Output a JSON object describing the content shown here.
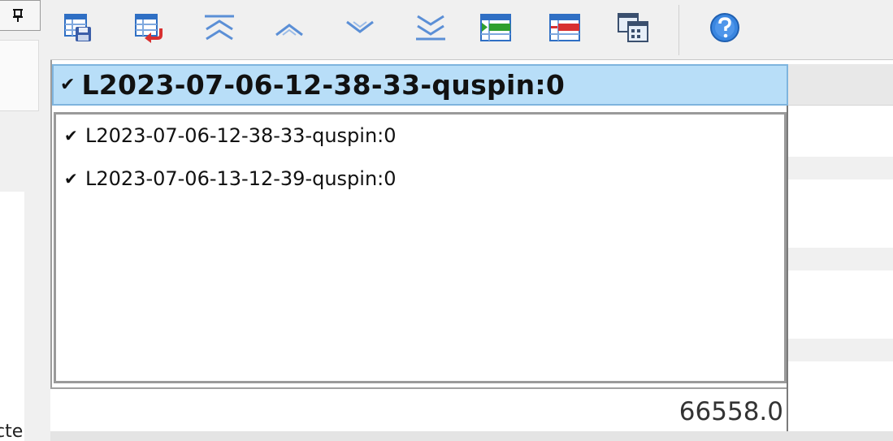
{
  "left_panel": {
    "pin_icon": "pin-icon",
    "truncated_text": "cte"
  },
  "toolbar": {
    "buttons": [
      {
        "name": "save-table",
        "icon": "table-save-icon"
      },
      {
        "name": "load-table",
        "icon": "table-load-icon"
      },
      {
        "name": "move-top",
        "icon": "double-chevron-up-icon"
      },
      {
        "name": "move-up",
        "icon": "chevron-up-icon"
      },
      {
        "name": "move-down",
        "icon": "chevron-down-icon"
      },
      {
        "name": "move-bottom",
        "icon": "double-chevron-down-icon"
      },
      {
        "name": "add-row",
        "icon": "table-add-icon"
      },
      {
        "name": "remove-row",
        "icon": "table-remove-icon"
      },
      {
        "name": "grid-view",
        "icon": "grid-window-icon"
      },
      {
        "name": "help",
        "icon": "help-icon"
      }
    ],
    "colors": {
      "table_blue": "#2f6fc4",
      "arrow_blue": "#5b8fd6",
      "add_green": "#2e9f2e",
      "remove_red": "#d83030",
      "help_blue": "#3a86e0"
    }
  },
  "combo": {
    "check": "✔",
    "selected": "L2023-07-06-12-38-33-quspin:0"
  },
  "list": {
    "items": [
      {
        "check": "✔",
        "label": "L2023-07-06-12-38-33-quspin:0"
      },
      {
        "check": "✔",
        "label": "L2023-07-06-13-12-39-quspin:0"
      }
    ]
  },
  "value_row": {
    "value": "66558.0"
  },
  "colors": {
    "combo_bg": "#b8def8",
    "combo_border": "#7eb4de",
    "stripe": "#f0f0f0"
  }
}
